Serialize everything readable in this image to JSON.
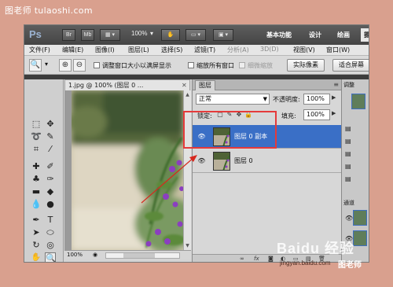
{
  "site_watermark": "图老师 tulaoshi.com",
  "titlebar": {
    "logo": "Ps",
    "br_label": "Br",
    "mb_label": "Mb",
    "zoom": "100%",
    "workspace_basic": "基本功能",
    "workspace_design": "设计",
    "workspace_paint": "绘画",
    "workspace_more": "摄"
  },
  "menu": [
    "文件(F)",
    "编辑(E)",
    "图像(I)",
    "图层(L)",
    "选择(S)",
    "滤镜(T)",
    "分析(A)",
    "3D(D)",
    "视图(V)",
    "窗口(W)"
  ],
  "options": {
    "resize_window": "调整窗口大小以满屏显示",
    "zoom_all": "缩放所有窗口",
    "scrubby": "细微缩放",
    "actual_pixels": "实际像素",
    "fit_screen": "适合屏幕"
  },
  "document": {
    "tab_title": "1.jpg @ 100% (图层 0 ...",
    "zoom": "100%"
  },
  "layers_panel": {
    "tab_label": "图层",
    "blend_mode": "正常",
    "opacity_label": "不透明度:",
    "opacity_value": "100%",
    "lock_label": "锁定:",
    "fill_label": "填充:",
    "fill_value": "100%",
    "layers": [
      {
        "name": "图层 0 副本",
        "selected": true,
        "visible": true
      },
      {
        "name": "图层 0",
        "selected": false,
        "visible": true
      }
    ],
    "footer_icons": [
      "link-icon",
      "fx-icon",
      "mask-icon",
      "adjustment-icon",
      "group-icon",
      "new-layer-icon",
      "trash-icon"
    ]
  },
  "right_panel": {
    "tab_adjust": "调整",
    "tab_channels": "通道"
  },
  "baidu_watermark": "Baidu 经验",
  "baidu_url": "jingyan.baidu.com",
  "corner_watermark": "图老师",
  "colors": {
    "page_bg": "#d9a08e",
    "selection_blue": "#3a6fc6",
    "highlight_red": "#e53a3a",
    "foreground_swatch": "#e08a70"
  }
}
